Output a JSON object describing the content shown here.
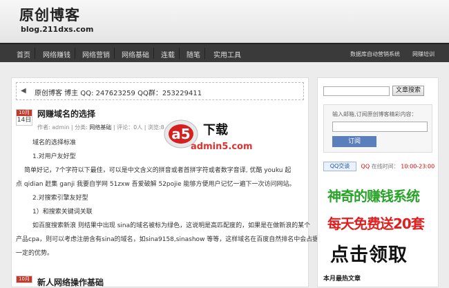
{
  "header": {
    "title": "原创博客",
    "subtitle": "blog.211dxs.com"
  },
  "nav": {
    "items": [
      "首页",
      "网络赚钱",
      "网络营销",
      "网络基础",
      "连载",
      "随笔",
      "实用工具"
    ],
    "right_items": [
      "数据库自动营销系统",
      "网赚培训"
    ]
  },
  "notice": {
    "text": "原创博客 博主 QQ: 247623259 QQ群：253229411"
  },
  "posts": [
    {
      "month": "10月",
      "day": "14日",
      "title": "网赚域名的选择",
      "meta_author": "作者: admin | 分类:",
      "meta_category": "网络基础",
      "meta_rest": "| 评论：0人 | 浏览:8"
    },
    {
      "month": "10月",
      "title": "新人网络操作基础"
    }
  ],
  "post_body": [
    "域名的选择标准",
    "1.对用户友好型",
    "简单好记，7个字符以下最佳，可以是中文含义的拼音或者首拼字符或者数字音译, 优酷 youku 起",
    "点 qidian 赶集 ganji 我要自学网 51zxw 吾爱破解 52pojie 能够方便用户记忆一遍下一次访问网站。",
    "2.对搜索引擎友好型",
    "1）和搜索关键词关联",
    "如百度搜索新浪 则结果中出现 sina的域名被标为绿色，这说明是高匹配度的，如果是在做新浪的某个",
    "产品cpa，则可以考虑注册含有sina的域名，如sina9158,sinashow 等等，这样域名在百度自然排名中会占据",
    "一定的优势。"
  ],
  "watermark": {
    "big": "a5",
    "suffix": "下载",
    "url": "admin5.com"
  },
  "sidebar": {
    "search_button": "文章搜索",
    "subscribe_label": "输入邮箱,订阅原创博客精彩内容：",
    "subscribe_button": "订阅",
    "qq_badge": "QQ交谈",
    "qq_status": "QQ",
    "qq_online": "在线时间：",
    "qq_time": "10:00-23:00",
    "ad_line1": "神奇的赚钱系统",
    "ad_line2": "每天免费送20套",
    "ad_line3": "点击领取",
    "section_title": "本月最热文章"
  },
  "colors": {
    "nav_bg": "#3a3a3a",
    "date_red": "#c0392b",
    "ad_green": "#2aa32a",
    "ad_red": "#e02020",
    "accent_blue": "#5a7fbf"
  }
}
